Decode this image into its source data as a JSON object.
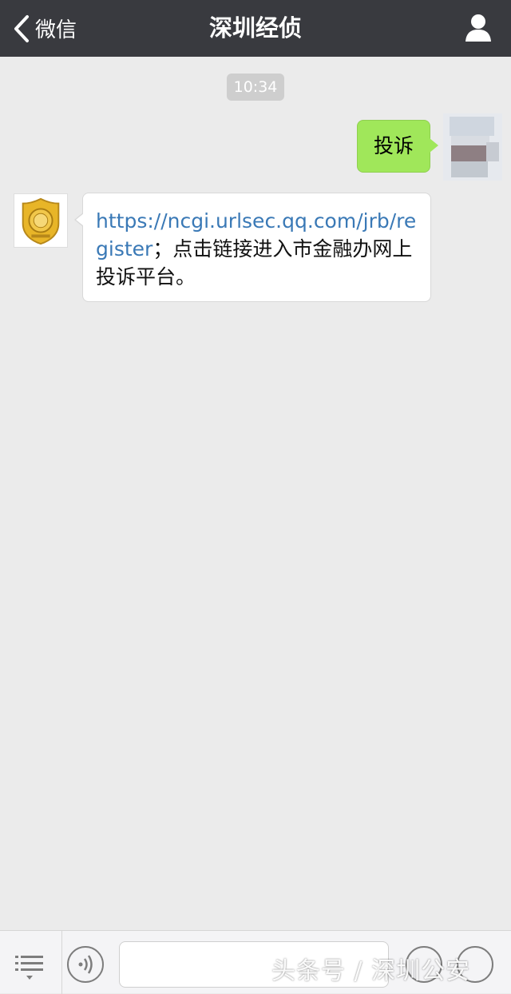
{
  "nav": {
    "back_label": "微信",
    "title": "深圳经侦"
  },
  "chat": {
    "timestamp": "10:34",
    "outgoing": {
      "text": "投诉"
    },
    "incoming": {
      "link": "https://ncgi.urlsec.qq.com/jrb/register",
      "text": "；点击链接进入市金融办网上投诉平台。"
    }
  },
  "watermark": "头条号 / 深圳公安",
  "icons": {
    "back": "chevron-left-icon",
    "profile": "person-icon",
    "menu": "menu-list-icon",
    "voice": "voice-icon",
    "emoji": "emoji-icon",
    "plus": "plus-icon"
  },
  "colors": {
    "navbar": "#393a3f",
    "background": "#ebebeb",
    "outgoing_bubble": "#a0e75a",
    "link": "#3a79b6"
  }
}
